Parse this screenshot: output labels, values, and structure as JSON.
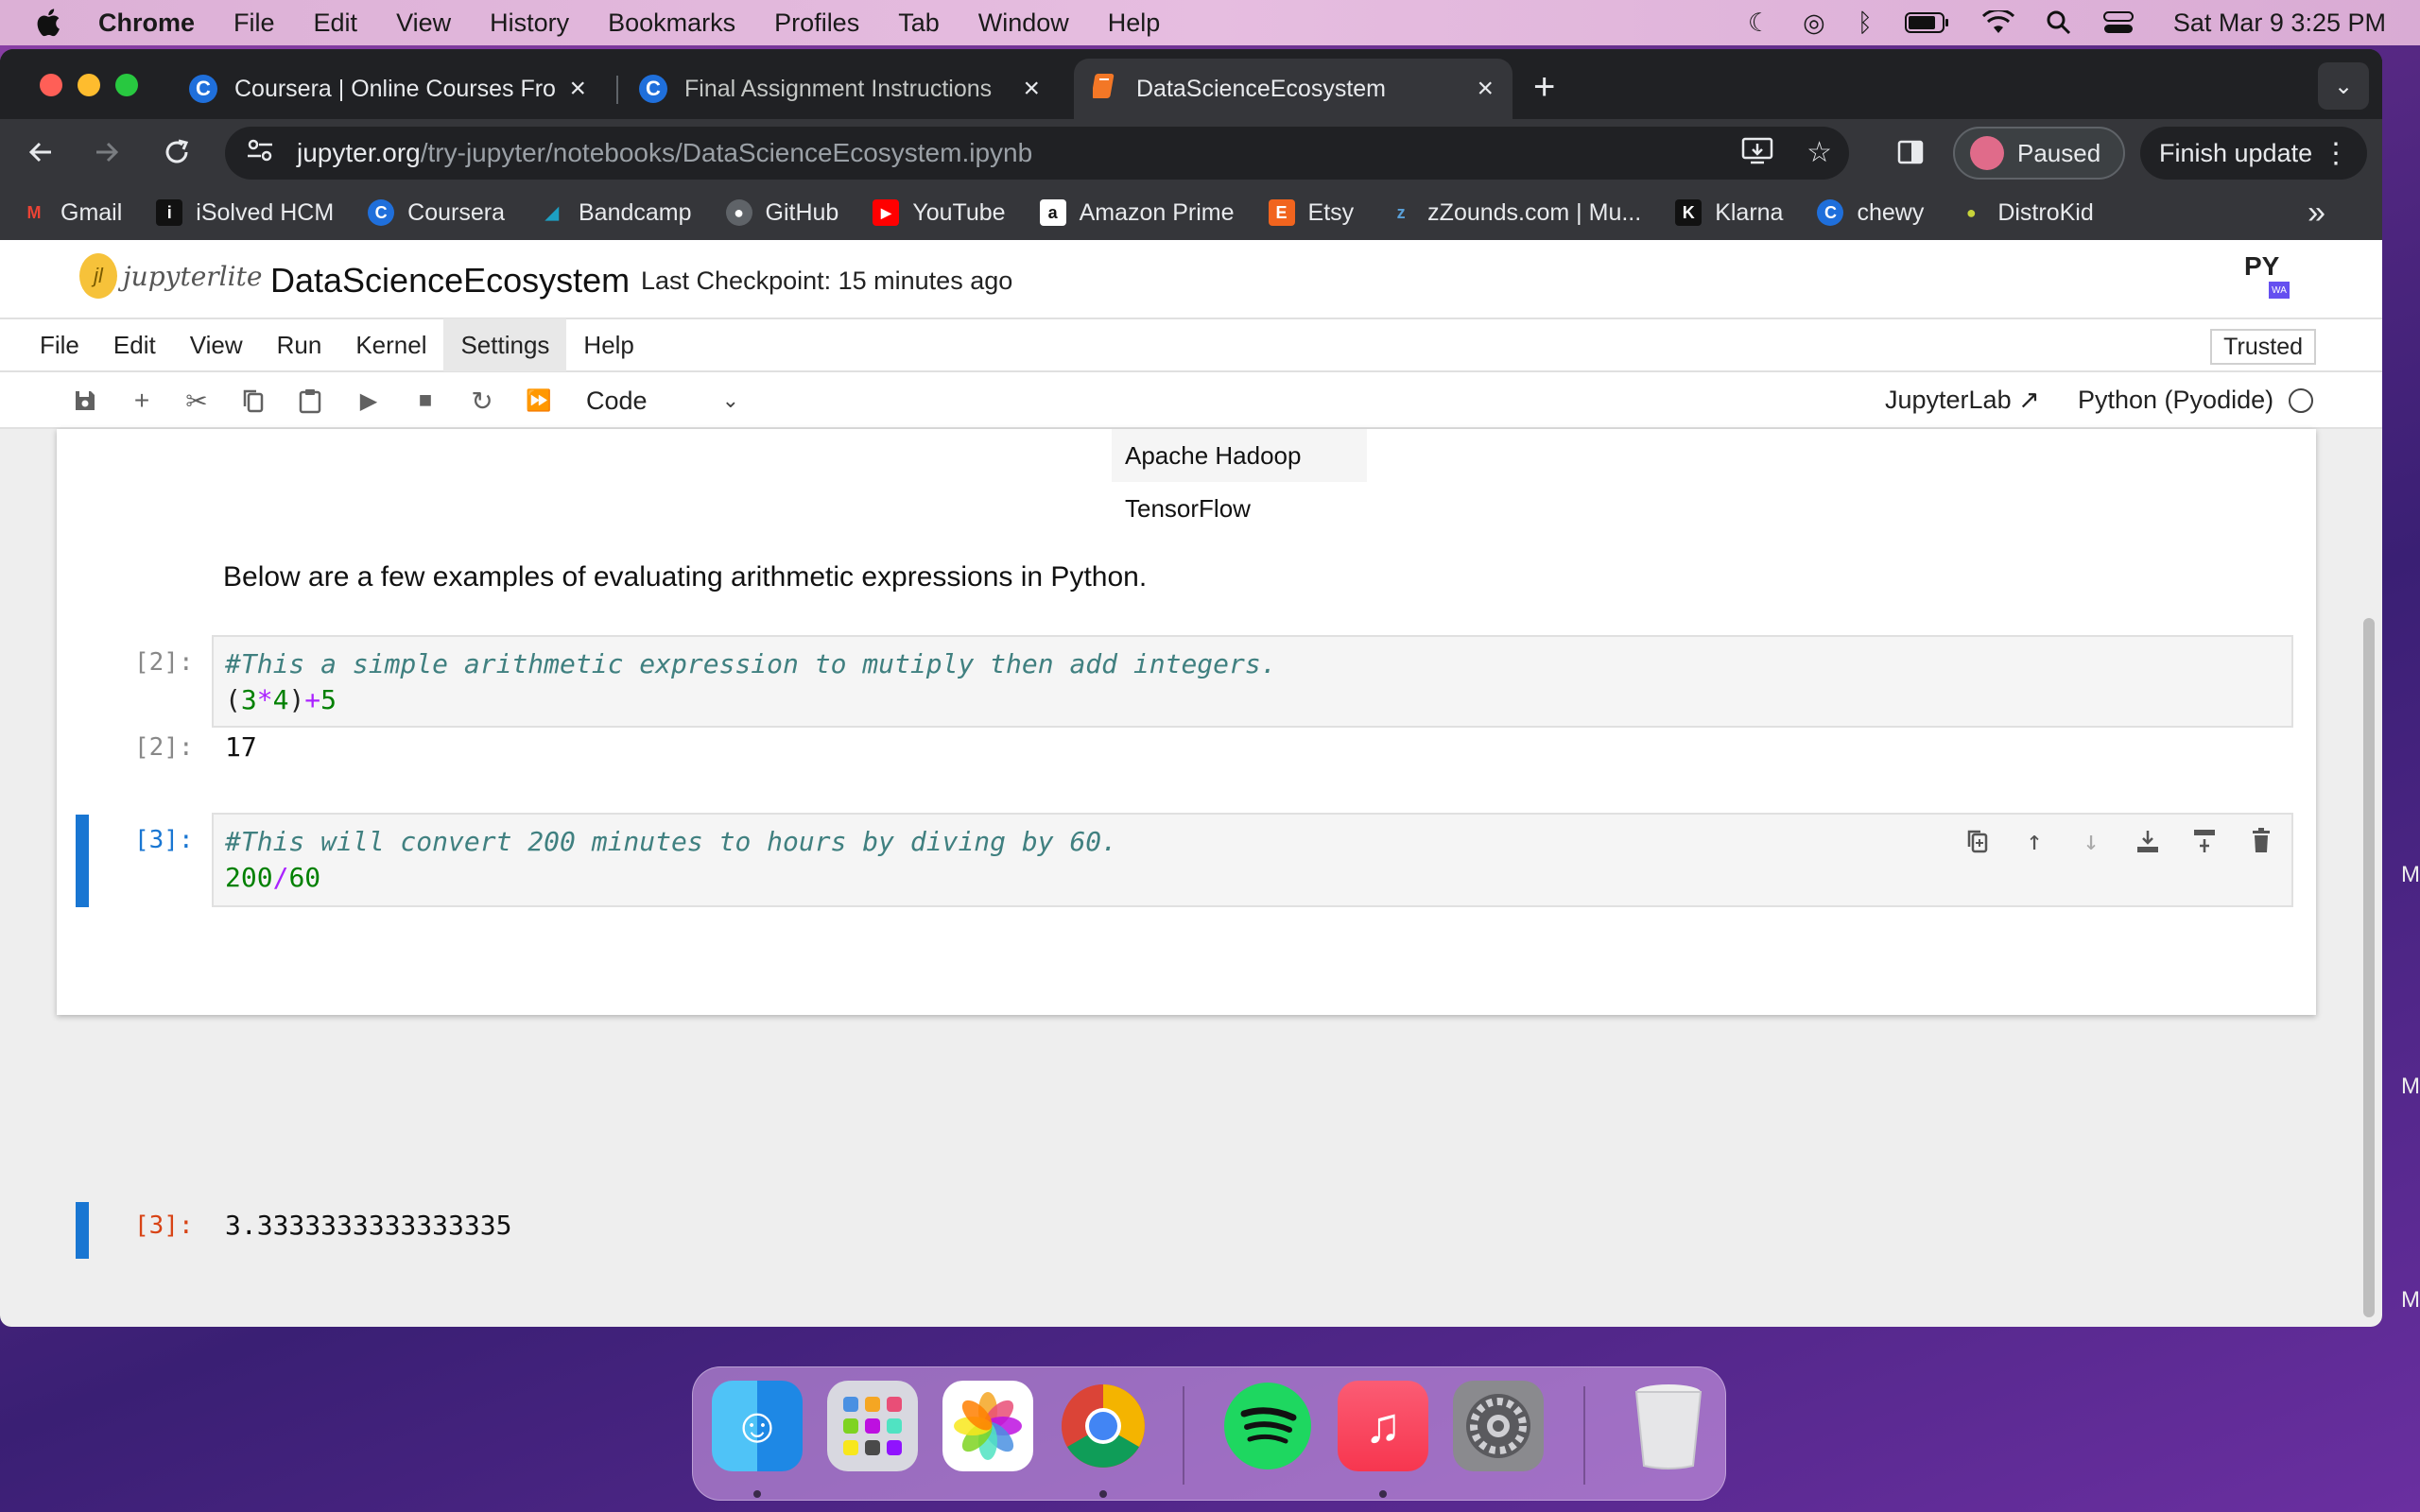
{
  "menubar": {
    "app": "Chrome",
    "items": [
      "File",
      "Edit",
      "View",
      "History",
      "Bookmarks",
      "Profiles",
      "Tab",
      "Window",
      "Help"
    ],
    "clock": "Sat Mar 9  3:25 PM"
  },
  "tabs": [
    {
      "title": "Coursera | Online Courses Fro",
      "icon": "coursera-icon"
    },
    {
      "title": "Final Assignment Instructions",
      "icon": "coursera-icon"
    },
    {
      "title": "DataScienceEcosystem",
      "icon": "jupyter-notebook-icon",
      "active": true
    }
  ],
  "address": {
    "host": "jupyter.org",
    "path": "/try-jupyter/notebooks/DataScienceEcosystem.ipynb"
  },
  "profile": {
    "label": "Paused"
  },
  "update": {
    "label": "Finish update"
  },
  "bookmarks": [
    {
      "label": "Gmail",
      "color": "#ea4335",
      "glyph": "M"
    },
    {
      "label": "iSolved HCM",
      "color": "#111111",
      "glyph": "i"
    },
    {
      "label": "Coursera",
      "color": "#1f6fdb",
      "glyph": "C"
    },
    {
      "label": "Bandcamp",
      "color": "#1da0c3",
      "glyph": "◢"
    },
    {
      "label": "GitHub",
      "color": "#444444",
      "glyph": "●"
    },
    {
      "label": "YouTube",
      "color": "#ff0000",
      "glyph": "▶"
    },
    {
      "label": "Amazon Prime",
      "color": "#ffffff",
      "glyph": "a"
    },
    {
      "label": "Etsy",
      "color": "#f1641e",
      "glyph": "E"
    },
    {
      "label": "zZounds.com | Mu...",
      "color": "#5aa0d8",
      "glyph": "z"
    },
    {
      "label": "Klarna",
      "color": "#111111",
      "glyph": "K"
    },
    {
      "label": "chewy",
      "color": "#1f6fdb",
      "glyph": "C"
    },
    {
      "label": "DistroKid",
      "color": "#c8d43a",
      "glyph": "●"
    }
  ],
  "jupyter": {
    "logo_text": "jupyterlite",
    "notebook_title": "DataScienceEcosystem",
    "checkpoint": "Last Checkpoint: 15 minutes ago",
    "menu": [
      "File",
      "Edit",
      "View",
      "Run",
      "Kernel",
      "Settings",
      "Help"
    ],
    "trusted": "Trusted",
    "cell_type": "Code",
    "jupyterlab_link": "JupyterLab",
    "kernel": "Python (Pyodide)",
    "py_logo": "PY",
    "wa_badge": "WA"
  },
  "notebook": {
    "table_rows": [
      "Apache Hadoop",
      "TensorFlow"
    ],
    "markdown": "Below are a few examples of evaluating arithmetic expressions in Python.",
    "cells": [
      {
        "in_prompt": "[2]:",
        "comment": "#This a simple arithmetic expression to mutiply then add integers.",
        "code_parts": [
          "(",
          "3",
          "*",
          "4",
          ")",
          "+",
          "5"
        ],
        "out_prompt": "[2]:",
        "output": "17"
      },
      {
        "in_prompt": "[3]:",
        "comment": "#This will convert 200 minutes to hours by diving by 60.",
        "code_parts": [
          "200",
          "/",
          "60"
        ],
        "out_prompt": "[3]:",
        "output": "3.3333333333333335"
      }
    ]
  },
  "edge_letter": "M",
  "dock": [
    "finder-icon",
    "launchpad-icon",
    "photos-icon",
    "chrome-icon",
    "spotify-icon",
    "music-icon",
    "system-settings-icon",
    "trash-icon"
  ]
}
